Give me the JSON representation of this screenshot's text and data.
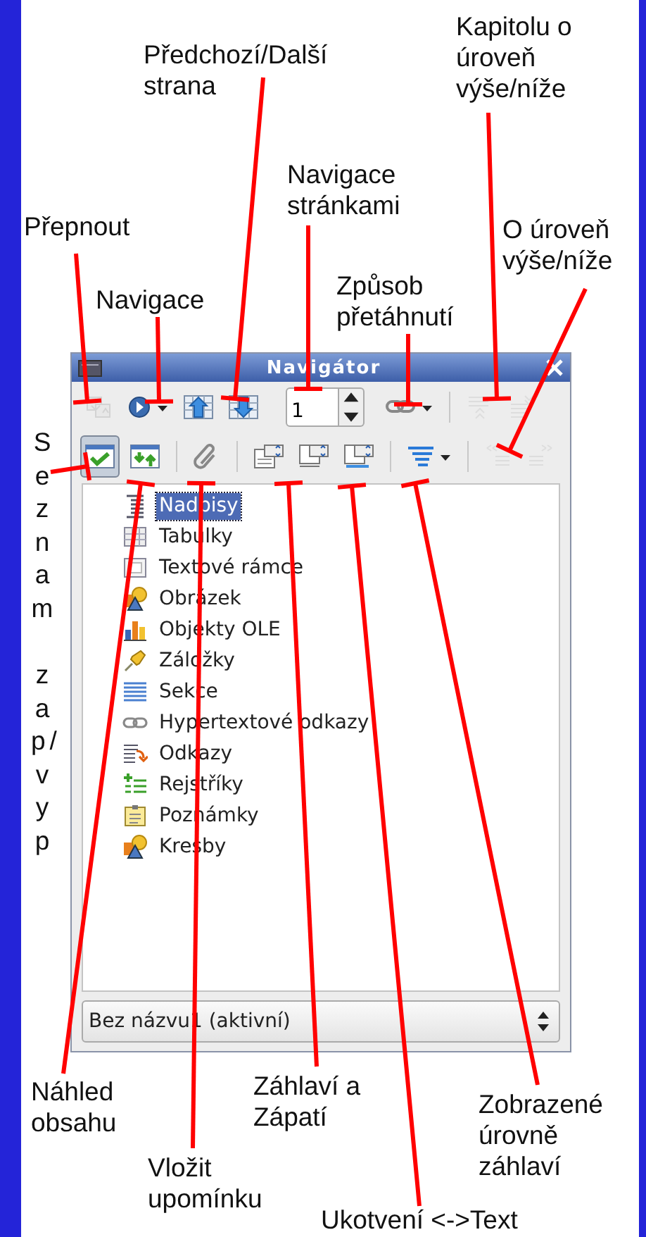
{
  "callouts": [
    {
      "text": "Předchozí/Další\nstrana"
    },
    {
      "text": "Kapitolu o\núroveň\nvýše/níže"
    },
    {
      "text": "Přepnout"
    },
    {
      "text": "Navigace\nstránkami"
    },
    {
      "text": "O úroveň\nvýše/níže"
    },
    {
      "text": "Navigace"
    },
    {
      "text": "Způsob\npřetáhnutí"
    },
    {
      "text": "Seznam",
      "kind": "vertical"
    },
    {
      "text": "zap/vyp",
      "kind": "vertical"
    },
    {
      "text": "Náhled\nobsahu"
    },
    {
      "text": "Záhlaví a\nZápatí"
    },
    {
      "text": "Vložit\nupomínku"
    },
    {
      "text": "Zobrazené\núrovně\nzáhlaví"
    },
    {
      "text": "Ukotvení <->Text"
    }
  ],
  "window": {
    "title": "Navigátor"
  },
  "toolbar": {
    "row_1": [
      [
        {
          "kind": "toggle",
          "disabled": true,
          "pressed": false
        },
        {
          "kind": "navigation",
          "disabled": false,
          "pressed": false
        },
        {
          "kind": "previous",
          "disabled": false,
          "pressed": false
        },
        {
          "kind": "next",
          "disabled": false,
          "pressed": false
        },
        {
          "kind": "page",
          "value": "1",
          "disabled": false
        },
        {
          "kind": "drag-mode",
          "disabled": false,
          "pressed": false
        }
      ],
      [
        {
          "kind": "chapter-up",
          "disabled": true,
          "pressed": false
        },
        {
          "kind": "chapter-down",
          "disabled": true,
          "pressed": false
        }
      ]
    ],
    "row_2": [
      [
        {
          "kind": "content-view",
          "disabled": false,
          "pressed": true
        },
        {
          "kind": "reminder",
          "disabled": false,
          "pressed": false
        }
      ],
      [
        {
          "kind": "clip",
          "disabled": false,
          "pressed": false
        }
      ],
      [
        {
          "kind": "header",
          "disabled": false,
          "pressed": false
        },
        {
          "kind": "footer",
          "disabled": false,
          "pressed": false
        },
        {
          "kind": "anchor",
          "disabled": false,
          "pressed": false
        }
      ],
      [
        {
          "kind": "levels",
          "disabled": false,
          "pressed": false
        }
      ],
      [
        {
          "kind": "promote",
          "disabled": true,
          "pressed": false
        },
        {
          "kind": "demote",
          "disabled": true,
          "pressed": false
        }
      ]
    ]
  },
  "tree": [
    {
      "label": "Nadpisy",
      "kind": "headings",
      "selected": true
    },
    {
      "label": "Tabulky",
      "kind": "tables",
      "selected": false
    },
    {
      "label": "Textové rámce",
      "kind": "frames",
      "selected": false
    },
    {
      "label": "Obrázek",
      "kind": "images",
      "selected": false
    },
    {
      "label": "Objekty OLE",
      "kind": "ole",
      "selected": false
    },
    {
      "label": "Záložky",
      "kind": "bookmarks",
      "selected": false
    },
    {
      "label": "Sekce",
      "kind": "sections",
      "selected": false
    },
    {
      "label": "Hypertextové odkazy",
      "kind": "hyperlinks",
      "selected": false
    },
    {
      "label": "Odkazy",
      "kind": "references",
      "selected": false
    },
    {
      "label": "Rejstříky",
      "kind": "indexes",
      "selected": false
    },
    {
      "label": "Poznámky",
      "kind": "comments",
      "selected": false
    },
    {
      "label": "Kresby",
      "kind": "drawings",
      "selected": false
    }
  ],
  "document": {
    "value": "Bez názvu1 (aktivní)"
  }
}
